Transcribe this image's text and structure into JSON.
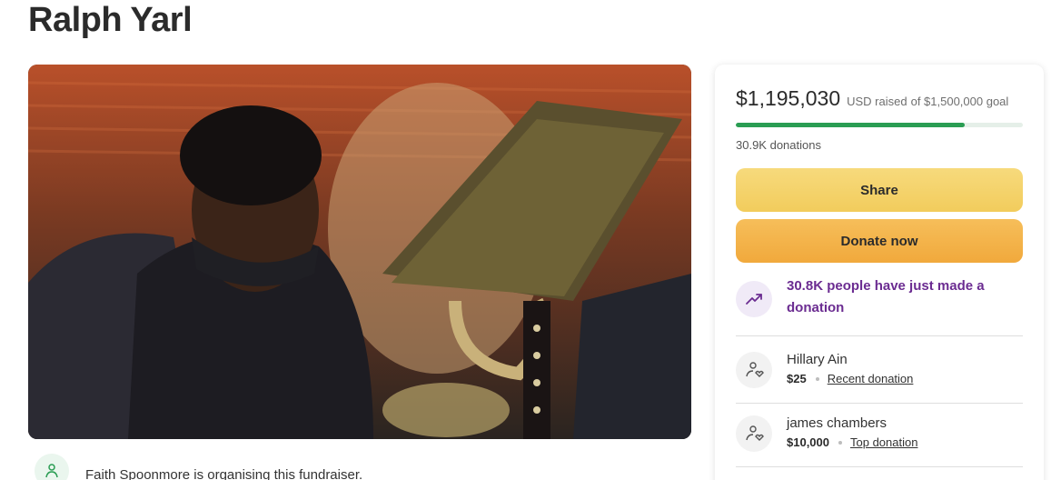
{
  "page": {
    "title": "Ralph Yarl"
  },
  "organiser": {
    "text": "Faith Spoonmore is organising this fundraiser."
  },
  "summary": {
    "amount": "$1,195,030",
    "currency": "USD raised",
    "goal_text": "of $1,500,000 goal",
    "progress_fraction": 0.797,
    "donations": "30.9K donations"
  },
  "buttons": {
    "share": "Share",
    "donate": "Donate now"
  },
  "trend": {
    "text": "30.8K people have just made a donation"
  },
  "donors": [
    {
      "name": "Hillary Ain",
      "amount": "$25",
      "tag": "Recent donation"
    },
    {
      "name": "james chambers",
      "amount": "$10,000",
      "tag": "Top donation"
    }
  ],
  "colors": {
    "progress": "#2a9d53",
    "share": "#f2cc5c",
    "donate": "#f1a93c",
    "trend_text": "#6b2c91"
  },
  "icons": {
    "organiser": "heart-hand-icon",
    "trend": "trending-up-icon",
    "donor": "heart-hand-icon"
  }
}
